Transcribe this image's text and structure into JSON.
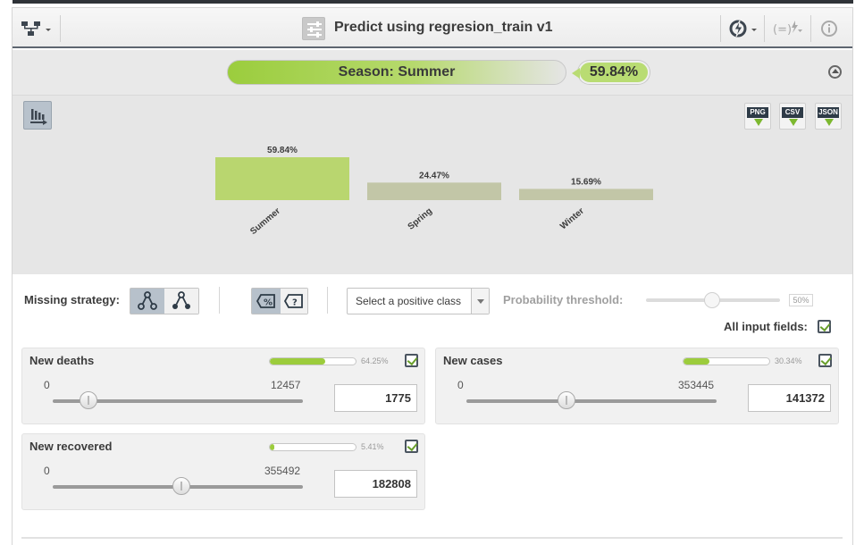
{
  "header": {
    "title": "Predict using regresion_train v1",
    "icons": [
      "model-tree-icon",
      "prediction-icon",
      "power-lightning-icon",
      "formula-lightning-icon",
      "info-icon"
    ]
  },
  "summary": {
    "prediction_label": "Season: Summer",
    "confidence": "59.84%"
  },
  "export_buttons": [
    "PNG",
    "CSV",
    "JSON"
  ],
  "chart_data": {
    "type": "bar",
    "categories": [
      "Summer",
      "Spring",
      "Winter"
    ],
    "values": [
      59.84,
      24.47,
      15.69
    ],
    "value_labels": [
      "59.84%",
      "24.47%",
      "15.69%"
    ],
    "colors": [
      "#b9d66f",
      "#c2c6a7",
      "#c2c6a7"
    ],
    "title": "",
    "xlabel": "",
    "ylabel": ""
  },
  "controls": {
    "missing_strategy_label": "Missing strategy:",
    "positive_class_placeholder": "Select a positive class",
    "probability_threshold_label": "Probability threshold:",
    "probability_threshold_value": "50%",
    "probability_threshold_fraction": 0.5,
    "all_input_fields_label": "All input fields:"
  },
  "fields": [
    {
      "name": "New deaths",
      "importance": "64.25%",
      "importance_fraction": 0.6425,
      "min": "0",
      "max": "12457",
      "value": "1775",
      "slider_fraction": 0.1425
    },
    {
      "name": "New cases",
      "importance": "30.34%",
      "importance_fraction": 0.3034,
      "min": "0",
      "max": "353445",
      "value": "141372",
      "slider_fraction": 0.4
    },
    {
      "name": "New recovered",
      "importance": "5.41%",
      "importance_fraction": 0.0541,
      "min": "0",
      "max": "355492",
      "value": "182808",
      "slider_fraction": 0.514
    }
  ]
}
